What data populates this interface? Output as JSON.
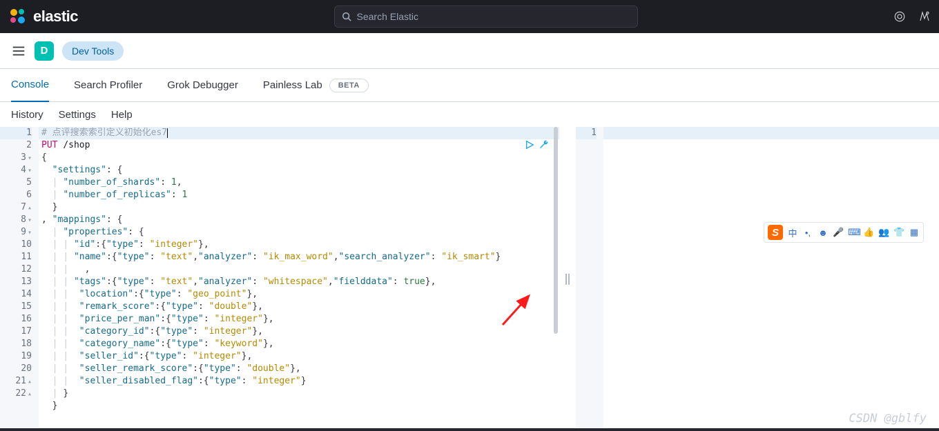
{
  "header": {
    "logo_text": "elastic",
    "search_placeholder": "Search Elastic"
  },
  "subheader": {
    "app_letter": "D",
    "breadcrumb": "Dev Tools"
  },
  "tabs": {
    "items": [
      "Console",
      "Search Profiler",
      "Grok Debugger",
      "Painless Lab"
    ],
    "active_index": 0,
    "beta_label": "BETA"
  },
  "toolbar": {
    "items": [
      "History",
      "Settings",
      "Help"
    ]
  },
  "editor": {
    "left_gutter": [
      {
        "n": "1",
        "fold": ""
      },
      {
        "n": "2",
        "fold": ""
      },
      {
        "n": "3",
        "fold": "▾"
      },
      {
        "n": "4",
        "fold": "▾"
      },
      {
        "n": "5",
        "fold": ""
      },
      {
        "n": "6",
        "fold": ""
      },
      {
        "n": "7",
        "fold": "▴"
      },
      {
        "n": "8",
        "fold": "▾"
      },
      {
        "n": "9",
        "fold": "▾"
      },
      {
        "n": "10",
        "fold": ""
      },
      {
        "n": "11",
        "fold": ""
      },
      {
        "n": "12",
        "fold": ""
      },
      {
        "n": "13",
        "fold": ""
      },
      {
        "n": "14",
        "fold": ""
      },
      {
        "n": "15",
        "fold": ""
      },
      {
        "n": "16",
        "fold": ""
      },
      {
        "n": "17",
        "fold": ""
      },
      {
        "n": "18",
        "fold": ""
      },
      {
        "n": "19",
        "fold": ""
      },
      {
        "n": "20",
        "fold": ""
      },
      {
        "n": "21",
        "fold": "▴"
      },
      {
        "n": "22",
        "fold": "▴"
      }
    ],
    "code_tokens": {
      "l1_comment": "# 点评搜索索引定义初始化es7",
      "l2_method": "PUT",
      "l2_path": "/shop",
      "settings_key": "\"settings\"",
      "shards_key": "\"number_of_shards\"",
      "shards_val": "1",
      "replicas_key": "\"number_of_replicas\"",
      "replicas_val": "1",
      "mappings_key": "\"mappings\"",
      "properties_key": "\"properties\"",
      "id_key": "\"id\"",
      "type_key": "\"type\"",
      "integer_val": "\"integer\"",
      "name_key": "\"name\"",
      "text_val": "\"text\"",
      "analyzer_key": "\"analyzer\"",
      "ik_max": "\"ik_max_word\"",
      "search_analyzer_key": "\"search_analyzer\"",
      "ik_smart": "\"ik_smart\"",
      "tags_key": "\"tags\"",
      "whitespace_val": "\"whitespace\"",
      "fielddata_key": "\"fielddata\"",
      "true_val": "true",
      "location_key": "\"location\"",
      "geo_val": "\"geo_point\"",
      "remark_key": "\"remark_score\"",
      "double_val": "\"double\"",
      "ppm_key": "\"price_per_man\"",
      "catid_key": "\"category_id\"",
      "catname_key": "\"category_name\"",
      "keyword_val": "\"keyword\"",
      "sellerid_key": "\"seller_id\"",
      "srs_key": "\"seller_remark_score\"",
      "sdf_key": "\"seller_disabled_flag\""
    },
    "right_gutter": [
      "1"
    ]
  },
  "ime": {
    "zh": "中",
    "icons": [
      "•,",
      "☻",
      "🎤",
      "⌨",
      "👍",
      "👥",
      "👕",
      "▦"
    ]
  },
  "watermark": "CSDN @gblfy"
}
